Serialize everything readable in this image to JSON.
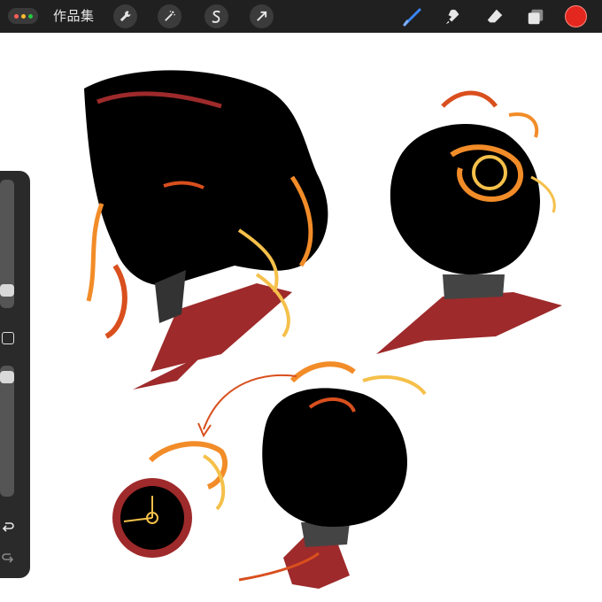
{
  "toolbar": {
    "gallery_label": "作品集",
    "tools_left": [
      "wrench-icon",
      "magic-wand-icon",
      "selection-s-icon",
      "transform-arrow-icon"
    ],
    "tools_right": [
      "brush-icon",
      "smudge-icon",
      "eraser-icon",
      "layers-icon"
    ],
    "current_color": "#e3271f",
    "brush_active_color": "#3a86ff"
  },
  "sidebar": {
    "brush_size_level": 0.25,
    "opacity_level": 0.95,
    "buttons": [
      "modify-square-icon",
      "undo-icon",
      "redo-icon"
    ]
  },
  "canvas": {
    "background": "#ffffff",
    "palette": [
      "#000000",
      "#9e2a2b",
      "#d94f1e",
      "#f28c28",
      "#f5c04a",
      "#444444"
    ]
  }
}
